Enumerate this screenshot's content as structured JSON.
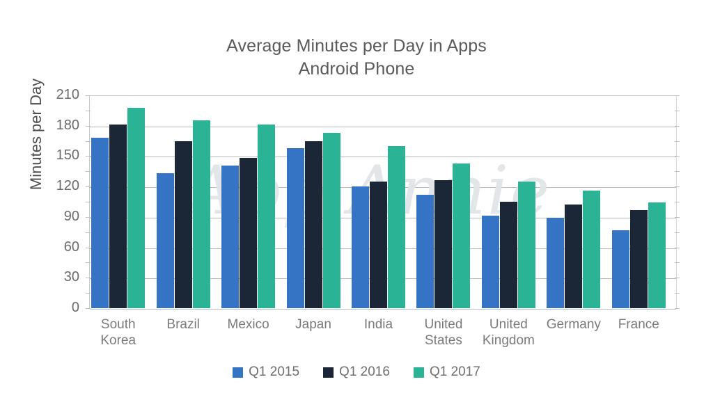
{
  "chart_data": {
    "type": "bar",
    "title": "Average Minutes per Day in Apps",
    "subtitle": "Android Phone",
    "xlabel": "",
    "ylabel": "Minutes per Day",
    "ylim": [
      0,
      210
    ],
    "ytick_step": 30,
    "yticks": [
      "210",
      "180",
      "150",
      "120",
      "90",
      "60",
      "30",
      "0"
    ],
    "grid": true,
    "legend_position": "bottom",
    "watermark": "App Annie",
    "categories": [
      "South Korea",
      "Brazil",
      "Mexico",
      "Japan",
      "India",
      "United States",
      "United Kingdom",
      "Germany",
      "France"
    ],
    "category_lines": [
      [
        "South",
        "Korea"
      ],
      [
        "Brazil"
      ],
      [
        "Mexico"
      ],
      [
        "Japan"
      ],
      [
        "India"
      ],
      [
        "United",
        "States"
      ],
      [
        "United",
        "Kingdom"
      ],
      [
        "Germany"
      ],
      [
        "France"
      ]
    ],
    "series": [
      {
        "name": "Q1 2015",
        "color": "#3573c4",
        "values": [
          168,
          133,
          141,
          158,
          120,
          112,
          91,
          89,
          77
        ]
      },
      {
        "name": "Q1 2016",
        "color": "#1b2636",
        "values": [
          181,
          165,
          148,
          165,
          125,
          126,
          105,
          102,
          97
        ]
      },
      {
        "name": "Q1 2017",
        "color": "#2ab394",
        "values": [
          198,
          185,
          181,
          173,
          160,
          143,
          125,
          116,
          104
        ]
      }
    ],
    "colors": {
      "q1_2015": "#3573c4",
      "q1_2016": "#1b2636",
      "q1_2017": "#2ab394",
      "grid": "#b9b9b9",
      "text": "#6b6b6b",
      "background": "#ffffff"
    }
  }
}
